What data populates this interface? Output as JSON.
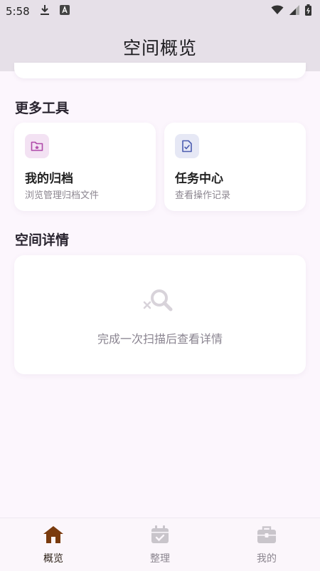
{
  "status_bar": {
    "time": "5:58",
    "icons": [
      "download-icon",
      "app-a-icon",
      "wifi-icon",
      "signal-icon",
      "battery-icon"
    ]
  },
  "header": {
    "title": "空间概览"
  },
  "more_tools": {
    "title": "更多工具",
    "items": [
      {
        "name": "我的归档",
        "desc": "浏览管理归档文件",
        "icon": "archive-folder-icon",
        "icon_bg": "#f3e2f3",
        "icon_color": "#b04aa9"
      },
      {
        "name": "任务中心",
        "desc": "查看操作记录",
        "icon": "task-document-icon",
        "icon_bg": "#e6e8f5",
        "icon_color": "#4c5db0"
      }
    ]
  },
  "space_detail": {
    "title": "空间详情",
    "empty_text": "完成一次扫描后查看详情",
    "icon": "search-x-icon"
  },
  "bottom_nav": {
    "items": [
      {
        "label": "概览",
        "icon": "home-icon",
        "active": true
      },
      {
        "label": "整理",
        "icon": "calendar-check-icon",
        "active": false
      },
      {
        "label": "我的",
        "icon": "briefcase-icon",
        "active": false
      }
    ]
  },
  "colors": {
    "background": "#fcf6fd",
    "app_bar": "#e6e0e8",
    "nav_active": "#7a3b0e",
    "nav_inactive": "#c9c5cb"
  }
}
